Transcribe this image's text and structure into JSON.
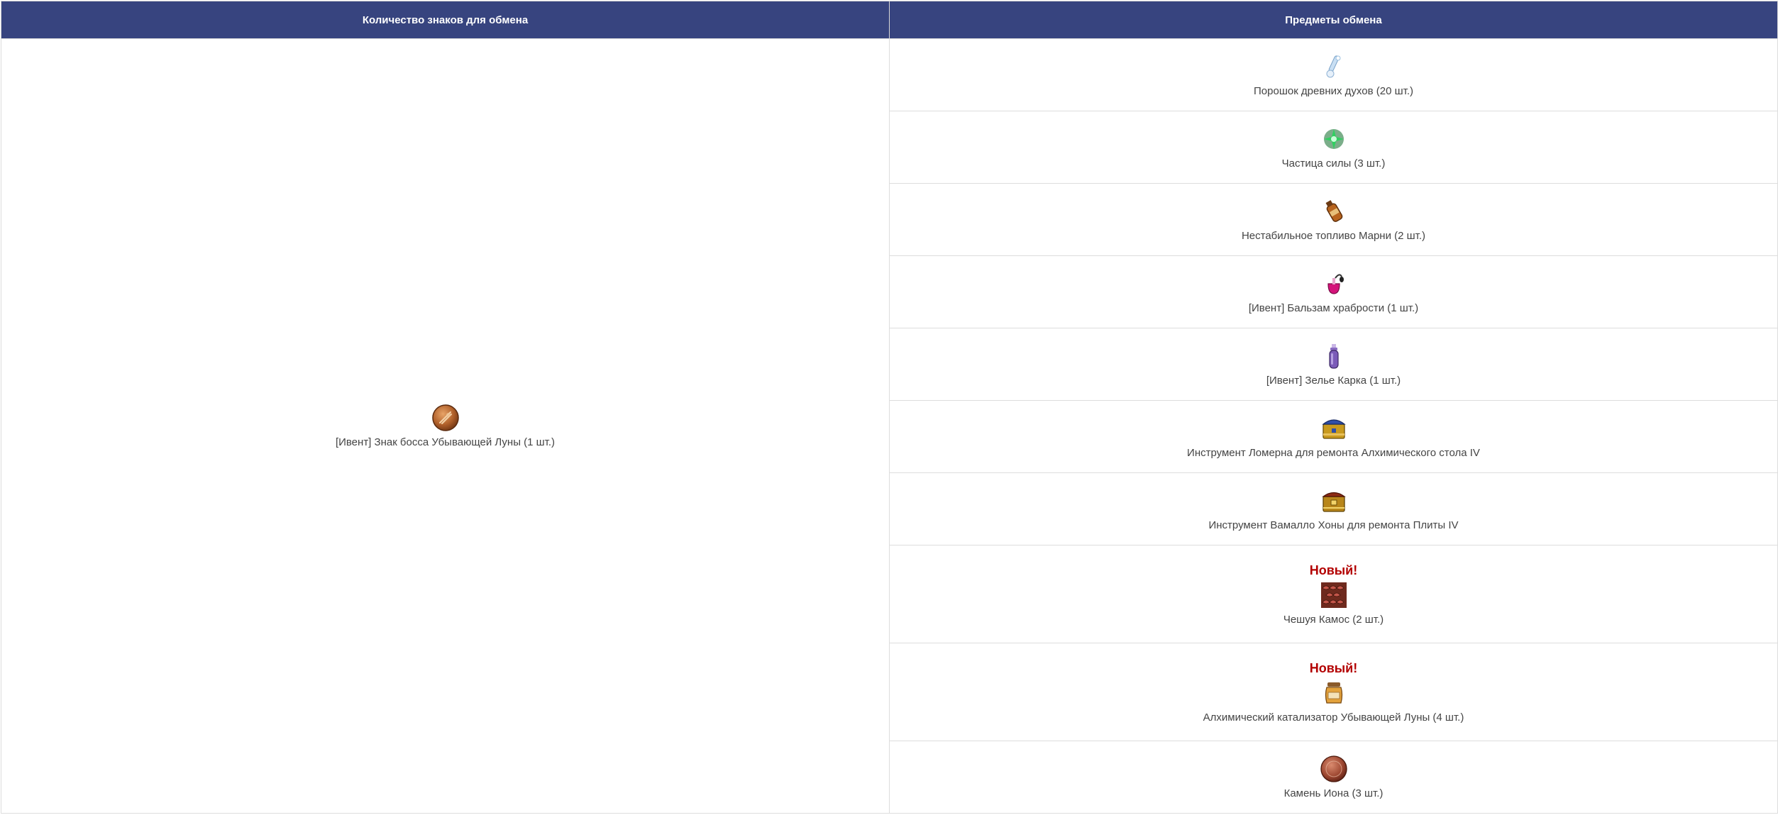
{
  "table": {
    "headers": {
      "left": "Количество знаков для обмена",
      "right": "Предметы обмена"
    },
    "source_item": {
      "label": "[Ивент] Знак босса Убывающей Луны (1 шт.)",
      "icon": "boss-token-coin-icon"
    },
    "items": [
      {
        "label": "Порошок древних духов (20 шт.)",
        "icon": "spirit-powder-icon",
        "badge": ""
      },
      {
        "label": "Частица силы (3 шт.)",
        "icon": "power-particle-icon",
        "badge": ""
      },
      {
        "label": "Нестабильное топливо Марни (2 шт.)",
        "icon": "fuel-bottle-icon",
        "badge": ""
      },
      {
        "label": "[Ивент] Бальзам храбрости (1 шт.)",
        "icon": "balm-perfume-icon",
        "badge": ""
      },
      {
        "label": "[Ивент] Зелье Карка (1 шт.)",
        "icon": "potion-bottle-icon",
        "badge": ""
      },
      {
        "label": "Инструмент Ломерна для ремонта Алхимического стола IV",
        "icon": "tool-chest-blue-icon",
        "badge": ""
      },
      {
        "label": "Инструмент Вамалло Хоны для ремонта Плиты IV",
        "icon": "tool-chest-gold-icon",
        "badge": ""
      },
      {
        "label": "Чешуя Камос (2 шт.)",
        "icon": "kamos-scale-icon",
        "badge": "Новый!"
      },
      {
        "label": "Алхимический катализатор Убывающей Луны (4 шт.)",
        "icon": "catalyst-jar-icon",
        "badge": "Новый!"
      },
      {
        "label": "Камень Иона (3 шт.)",
        "icon": "ion-stone-icon",
        "badge": ""
      }
    ]
  },
  "colors": {
    "header_bg": "#37447f",
    "header_text": "#ffffff",
    "badge_text": "#b30000",
    "body_text": "#444444",
    "border": "#dddddd"
  }
}
